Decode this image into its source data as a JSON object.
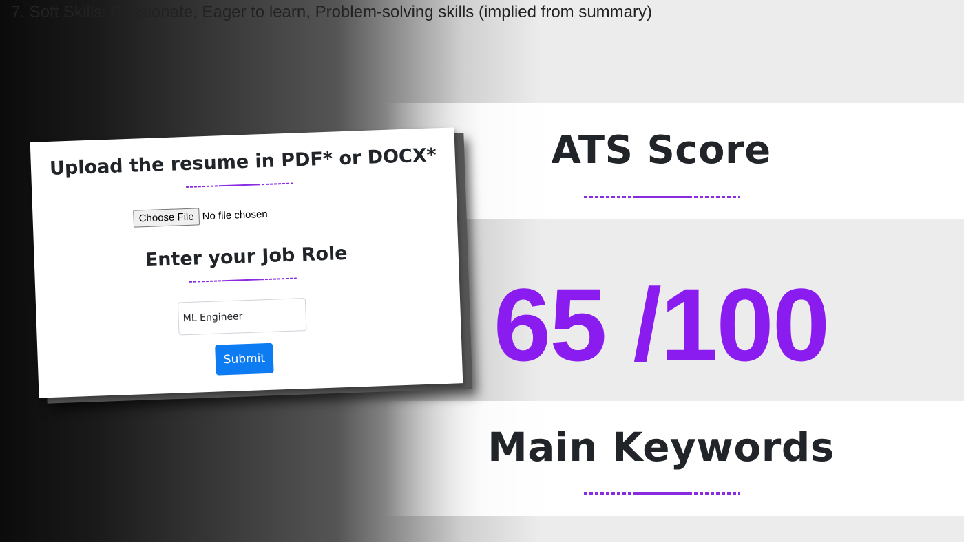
{
  "top_text": "7. Soft Skills:  Passionate, Eager to learn, Problem-solving skills (implied from summary)",
  "upload_card": {
    "upload_title": "Upload the resume in PDF* or DOCX*",
    "file_button_label": "Choose File",
    "file_status": "No file chosen",
    "job_role_title": "Enter your Job Role",
    "job_role_value": "ML Engineer",
    "submit_label": "Submit"
  },
  "results": {
    "ats_title": "ATS Score",
    "score_text": "65 /100",
    "score": 65,
    "score_max": 100,
    "keywords_title": "Main Keywords"
  },
  "colors": {
    "accent": "#8a1cf0",
    "submit": "#0d7cf2",
    "heading": "#212529"
  }
}
